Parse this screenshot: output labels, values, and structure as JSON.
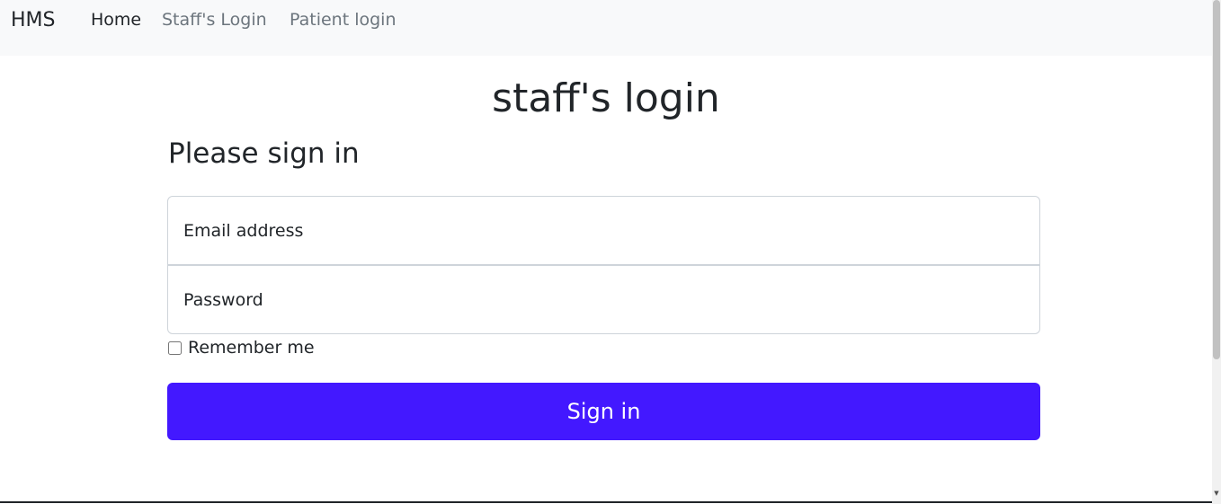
{
  "navbar": {
    "brand": "HMS",
    "links": [
      {
        "label": "Home",
        "active": true
      },
      {
        "label": "Staff's Login",
        "active": false
      },
      {
        "label": "Patient login",
        "active": false
      }
    ]
  },
  "main": {
    "title": "staff's login",
    "subtitle": "Please sign in",
    "email_placeholder": "Email address",
    "password_placeholder": "Password",
    "remember_label": "Remember me",
    "remember_checked": false,
    "signin_label": "Sign in"
  },
  "colors": {
    "accent": "#4318ff",
    "navbar_bg": "#f8f9fa",
    "active_link": "#212529",
    "inactive_link": "#6c757d"
  },
  "icons": {
    "scroll_down": "triangle-down"
  }
}
